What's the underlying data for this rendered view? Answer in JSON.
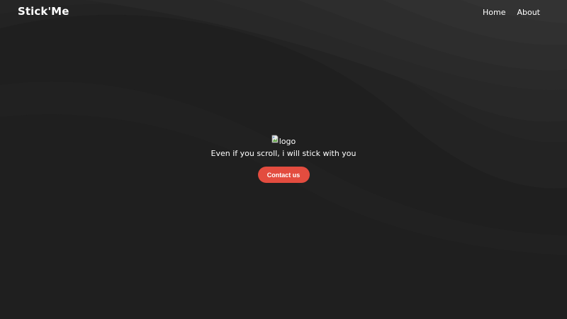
{
  "navbar": {
    "brand": "Stick'Me",
    "links": [
      {
        "label": "Home"
      },
      {
        "label": "About"
      }
    ]
  },
  "hero": {
    "logo_alt": "logo",
    "tagline": "Even if you scroll, i will stick with you",
    "cta_label": "Contact us"
  },
  "colors": {
    "background": "#1f1f1f",
    "accent": "#e34c3f",
    "text": "#ffffff"
  }
}
